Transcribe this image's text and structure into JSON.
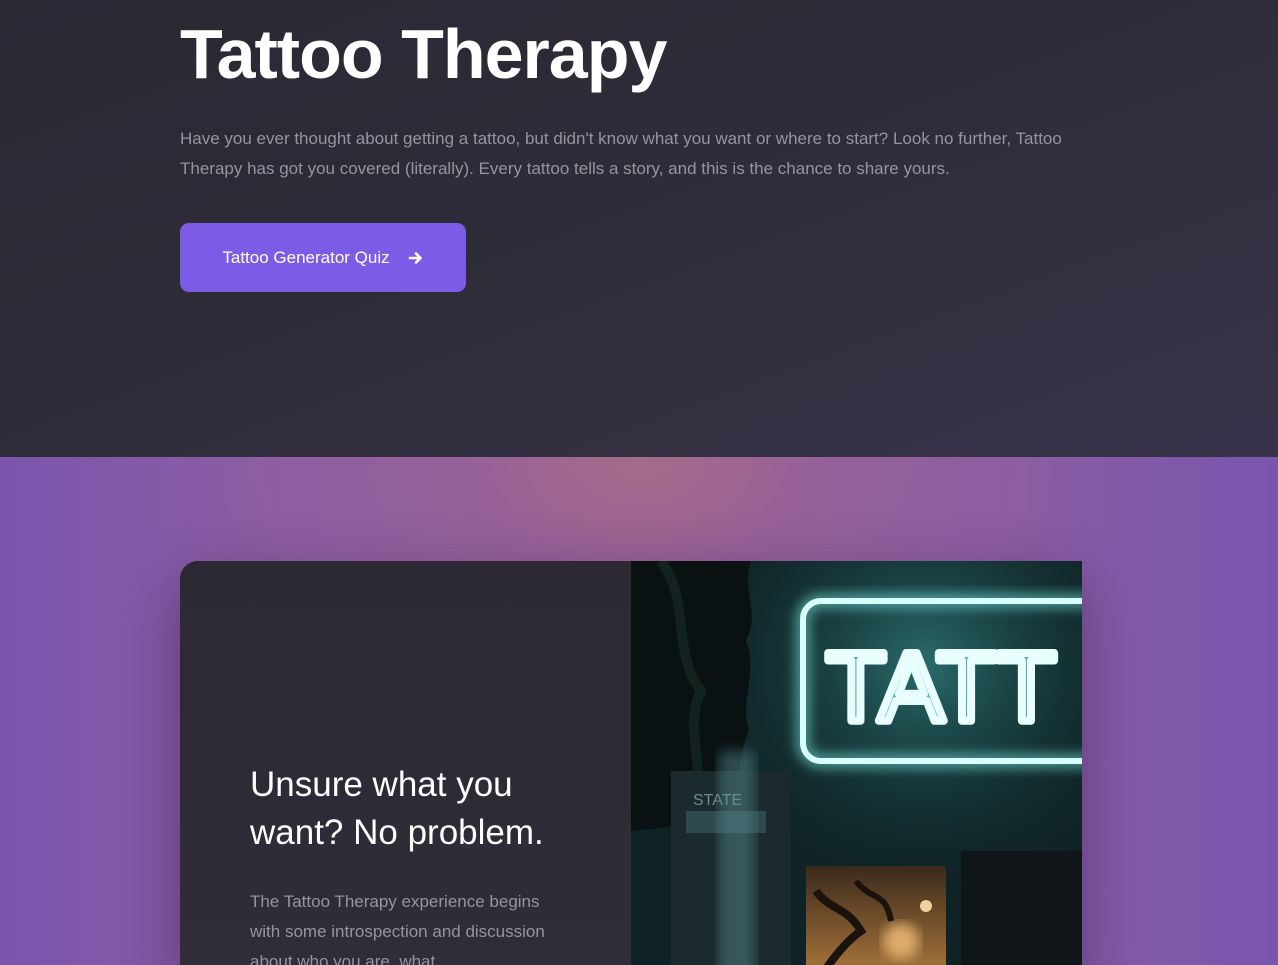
{
  "hero": {
    "title": "Tattoo Therapy",
    "description": "Have you ever thought about getting a tattoo, but didn't know what you want or where to start? Look no further, Tattoo Therapy has got you covered (literally). Every tattoo tells a story, and this is the chance to share yours.",
    "cta_label": "Tattoo Generator Quiz",
    "cta_icon": "arrow-right-icon"
  },
  "feature": {
    "heading": "Unsure what you want? No problem.",
    "body": "The Tattoo Therapy experience begins with some introspection and discussion about who you are, what",
    "photo": {
      "subject": "neon-tattoo-sign",
      "sign_text": "TATT",
      "storefront_text": "STATE"
    }
  },
  "colors": {
    "accent": "#7c5ce6",
    "hero_bg": "#2c2935",
    "section_bg": "#8a5da3",
    "neon": "#7ff0ec",
    "muted_text": "#97939f"
  }
}
